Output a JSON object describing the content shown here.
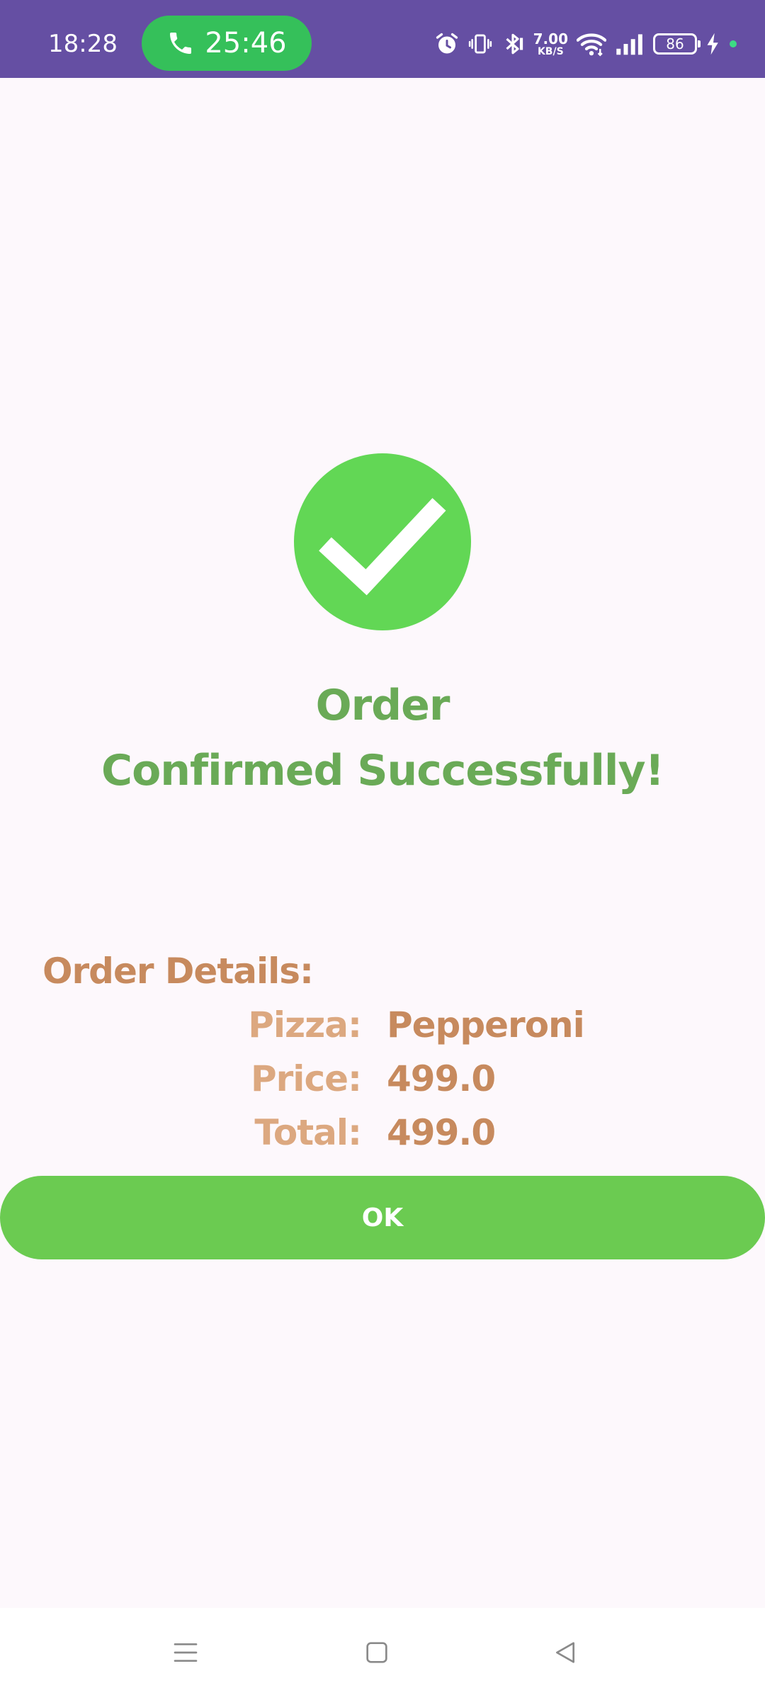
{
  "status_bar": {
    "time": "18:28",
    "call_timer": "25:46",
    "net_speed_value": "7.00",
    "net_speed_unit": "KB/S",
    "battery_level": "86",
    "icons": [
      "alarm-icon",
      "vibrate-icon",
      "bluetooth-icon",
      "wifi-icon",
      "signal-icon",
      "battery-icon",
      "charging-icon"
    ]
  },
  "confirmation": {
    "icon": "check-icon",
    "title_line1": "Order",
    "title_line2": "Confirmed Successfully!"
  },
  "order_details": {
    "heading": "Order Details:",
    "rows": [
      {
        "label": "Pizza:",
        "value": "Pepperoni"
      },
      {
        "label": "Price:",
        "value": "499.0"
      },
      {
        "label": "Total:",
        "value": "499.0"
      }
    ]
  },
  "actions": {
    "ok_label": "OK"
  },
  "nav_bar": {
    "icons": [
      "menu-icon",
      "home-icon",
      "back-icon"
    ]
  },
  "colors": {
    "status_bar": "#654fa3",
    "call_pill": "#35c05a",
    "success": "#62d755",
    "title": "#6aaa57",
    "details_label": "#dca880",
    "details_value": "#c78a5e",
    "button": "#6bcb51",
    "background": "#fdf8fc"
  }
}
